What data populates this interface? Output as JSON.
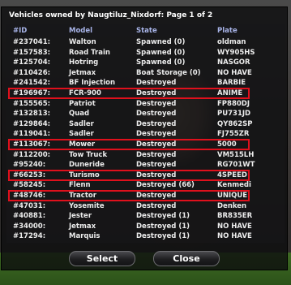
{
  "dialog": {
    "title": "Vehicles owned by Naugtiluz_Nixdorf: Page 1 of 2",
    "columns": [
      "#ID",
      "Model",
      "State",
      "Plate"
    ],
    "rows": [
      {
        "id": "#237041:",
        "model": "Walton",
        "state": "Spawned (0)",
        "plate": "oldman"
      },
      {
        "id": "#157583:",
        "model": "Road Train",
        "state": "Spawned (0)",
        "plate": "WY905HS"
      },
      {
        "id": "#125704:",
        "model": "Hotring",
        "state": "Spawned (0)",
        "plate": "NASGOR"
      },
      {
        "id": "#110426:",
        "model": "Jetmax",
        "state": "Boat Storage (0)",
        "plate": "NO HAVE"
      },
      {
        "id": "#241542:",
        "model": "BF Injection",
        "state": "Destroyed",
        "plate": "BARBIE"
      },
      {
        "id": "#196967:",
        "model": "FCR-900",
        "state": "Destroyed",
        "plate": "ANIME"
      },
      {
        "id": "#155565:",
        "model": "Patriot",
        "state": "Destroyed",
        "plate": "FP880DJ"
      },
      {
        "id": "#132813:",
        "model": "Quad",
        "state": "Destroyed",
        "plate": "PU731JD"
      },
      {
        "id": "#129864:",
        "model": "Sadler",
        "state": "Destroyed",
        "plate": "QY862SP"
      },
      {
        "id": "#119041:",
        "model": "Sadler",
        "state": "Destroyed",
        "plate": "FJ755ZR"
      },
      {
        "id": "#113067:",
        "model": "Mower",
        "state": "Destroyed",
        "plate": "5000"
      },
      {
        "id": "#112200:",
        "model": "Tow Truck",
        "state": "Destroyed",
        "plate": "VM515LH"
      },
      {
        "id": "#95240:",
        "model": "Duneride",
        "state": "Destroyed",
        "plate": "RG701WT"
      },
      {
        "id": "#66253:",
        "model": "Turismo",
        "state": "Destroyed",
        "plate": "4SPEED"
      },
      {
        "id": "#58245:",
        "model": "Flenn",
        "state": "Destroyed (66)",
        "plate": "Kenmedi"
      },
      {
        "id": "#48746:",
        "model": "Tractor",
        "state": "Destroyed",
        "plate": "UNIQUE"
      },
      {
        "id": "#47031:",
        "model": "Yosemite",
        "state": "Destroyed",
        "plate": "Denken"
      },
      {
        "id": "#40881:",
        "model": "Jester",
        "state": "Destroyed (1)",
        "plate": "BR835ER"
      },
      {
        "id": "#34000:",
        "model": "Jetmax",
        "state": "Destroyed (1)",
        "plate": "NO HAVE"
      },
      {
        "id": "#17294:",
        "model": "Marquis",
        "state": "Destroyed (1)",
        "plate": "NO HAVE"
      }
    ],
    "highlighted_rows": [
      5,
      10,
      13,
      15
    ],
    "highlight_color": "#e0101c",
    "header_color": "#a8b4e8",
    "buttons": {
      "select_label": "Select",
      "close_label": "Close"
    }
  }
}
